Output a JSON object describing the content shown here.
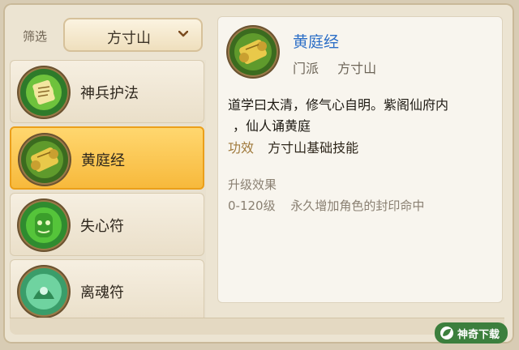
{
  "filter": {
    "label": "筛选",
    "selected": "方寸山"
  },
  "skills": [
    {
      "name": "神兵护法",
      "icon": "glowing-scroll-icon",
      "selected": false
    },
    {
      "name": "黄庭经",
      "icon": "golden-scroll-icon",
      "selected": true
    },
    {
      "name": "失心符",
      "icon": "green-spirit-icon",
      "selected": false
    },
    {
      "name": "离魂符",
      "icon": "green-ghost-icon",
      "selected": false
    }
  ],
  "detail": {
    "icon": "golden-scroll-icon",
    "title": "黄庭经",
    "sect_label": "门派",
    "sect_value": "方寸山",
    "description_line1": "道学曰太清，修气心自明。紫阁仙府内",
    "description_line2": "，仙人诵黄庭",
    "effect_label": "功效",
    "effect_value": "方寸山基础技能",
    "upgrade_title": "升级效果",
    "upgrade_range": "0-120级",
    "upgrade_effect": "永久增加角色的封印命中"
  },
  "watermark": {
    "text": "神奇下载",
    "icon": "leaf-logo-icon"
  },
  "colors": {
    "selected_item": "#f7b93c",
    "title_blue": "#2d6fc7"
  }
}
